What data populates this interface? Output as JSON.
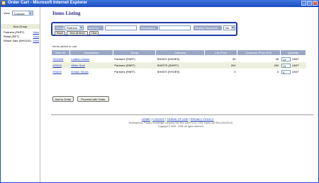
{
  "window": {
    "title": "Order Cart - Microsoft Internet Explorer"
  },
  "sidebar": {
    "view_label": "View",
    "view_value": "Concore",
    "group_header": "Non-Group",
    "items": [
      {
        "name": "Partners (PART)",
        "action": "View"
      },
      {
        "name": "Retail (RET)",
        "action": "View"
      },
      {
        "name": "Whole Sale (WHOLE)",
        "action": "View"
      }
    ]
  },
  "page": {
    "title": "Items Listing"
  },
  "search": {
    "group_label": "Group",
    "group_value": "Partners",
    "item_no_label": "Item No.",
    "description_label": "Description",
    "sort_label": "Display Sequence",
    "sort_value": "No",
    "reset_label": "Reset",
    "view_all_label": "View all Items",
    "clear_label": "Clear"
  },
  "status": {
    "added_text": "Items added to cart"
  },
  "table": {
    "headers": [
      "Item No",
      "Description",
      "Group",
      "Category",
      "List Price",
      "Customer Price (5%)",
      "Quantity"
    ],
    "rows": [
      {
        "item_no": "HG1000",
        "description": "Leather Shoes",
        "group": "Partners (PART)",
        "category": "SHOES (SHOES)",
        "list_price": "40",
        "customer_price": "40",
        "quantity": "11",
        "unit": "UNIT"
      },
      {
        "item_no": "HS003",
        "description": "White Shirt",
        "group": "Partners (PART)",
        "category": "SHIRTS (SHIRT)",
        "list_price": "200",
        "customer_price": "290",
        "quantity": "11",
        "unit": "UNIT"
      },
      {
        "item_no": "HS003",
        "description": "Dream Shoes",
        "group": "Partners (PART)",
        "category": "SHOES (SHOES)",
        "list_price": "0",
        "customer_price": "0",
        "quantity": "0",
        "unit": "UNIT"
      }
    ]
  },
  "actions": {
    "add_to_order": "Add to Order",
    "proceed": "Proceed with Order"
  },
  "footer": {
    "links": [
      "HOME",
      "LOGOUT",
      "TERMS OF USE",
      "PRIVACY POLICY"
    ],
    "powered": "Developed by Primary Knowledge Company Sdn Bhd (487974-V) / GRL Eryem Sdn Bhd (244425-D)",
    "copyright": "Copyright © 2002 - 2005. All rights reserved."
  }
}
